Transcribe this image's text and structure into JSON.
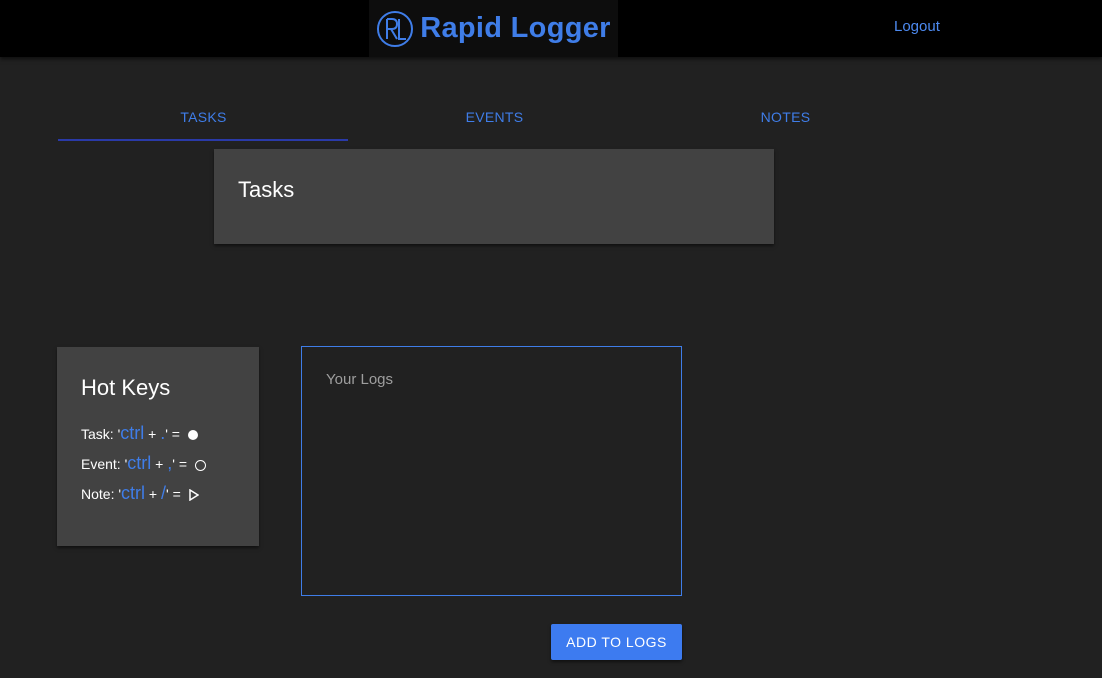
{
  "header": {
    "brand_name": "Rapid Logger",
    "logo_icon": "rl-monogram-icon",
    "logout_label": "Logout"
  },
  "tabs": [
    {
      "label": "TASKS",
      "active": true
    },
    {
      "label": "EVENTS",
      "active": false
    },
    {
      "label": "NOTES",
      "active": false
    }
  ],
  "tasks_card": {
    "title": "Tasks"
  },
  "hotkeys": {
    "title": "Hot Keys",
    "items": [
      {
        "label": "Task: '",
        "key": "ctrl",
        "plus": " + ",
        "char": ".",
        "close": "'",
        "equals": " = ",
        "symbol": "filled-circle-icon"
      },
      {
        "label": "Event: '",
        "key": "ctrl",
        "plus": " + ",
        "char": ",",
        "close": "'",
        "equals": " = ",
        "symbol": "empty-circle-icon"
      },
      {
        "label": "Note: '",
        "key": "ctrl",
        "plus": " + ",
        "char": "/",
        "close": "'",
        "equals": " = ",
        "symbol": "triangle-right-icon"
      }
    ]
  },
  "logs": {
    "placeholder": "Your Logs",
    "value": ""
  },
  "add_button_label": "ADD TO LOGS",
  "colors": {
    "accent": "#3f7de8",
    "background": "#212121",
    "card": "#424242",
    "topbar": "#000000"
  }
}
